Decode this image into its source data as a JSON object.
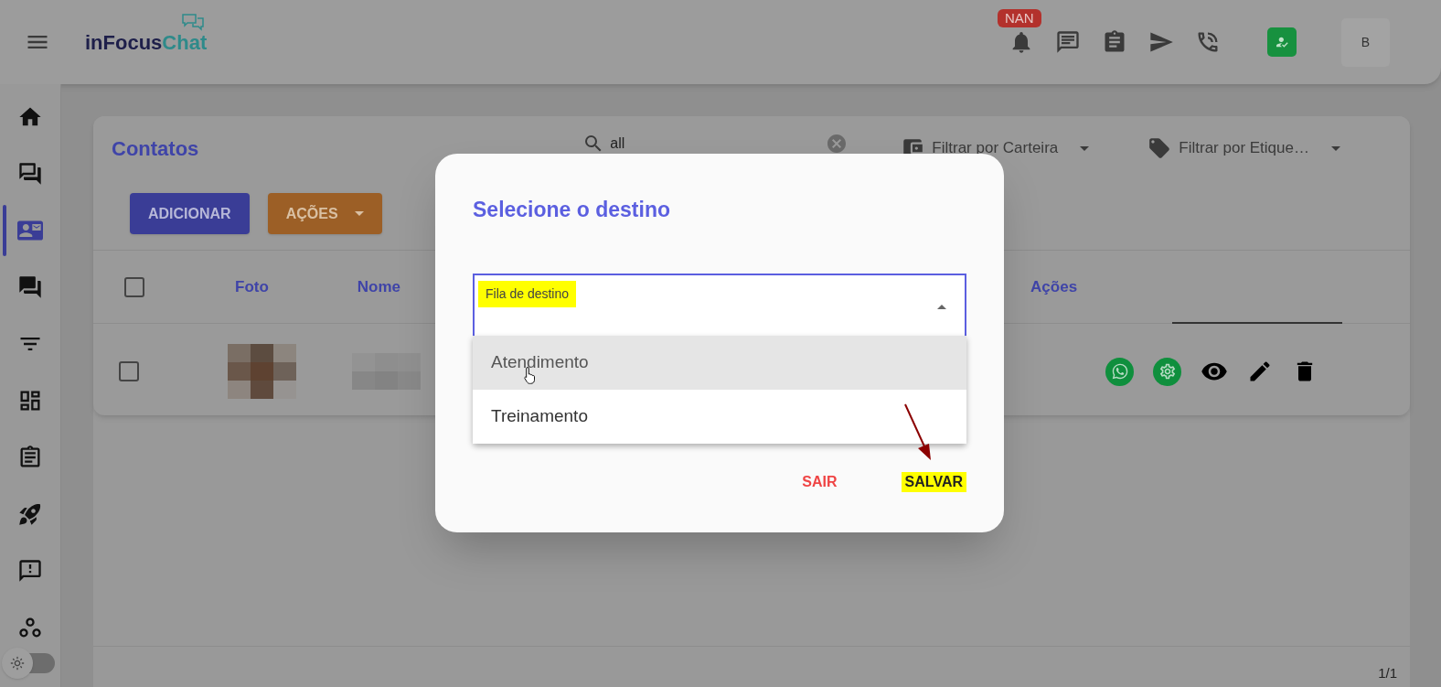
{
  "header": {
    "logo": {
      "dark_part": "inFocus",
      "accent_part": "Chat"
    },
    "notification_badge": "NAN",
    "avatar": "B"
  },
  "sidebar": {
    "items": [
      {
        "kind": "home",
        "selected": false
      },
      {
        "kind": "forum",
        "selected": false
      },
      {
        "kind": "contacts",
        "selected": true
      },
      {
        "kind": "chat",
        "selected": false
      },
      {
        "kind": "filter",
        "selected": false
      },
      {
        "kind": "dashboard",
        "selected": false
      },
      {
        "kind": "tasks",
        "selected": false
      },
      {
        "kind": "rocket",
        "selected": false
      },
      {
        "kind": "feedback",
        "selected": false
      },
      {
        "kind": "hexagons",
        "selected": false
      }
    ],
    "theme_toggle": {
      "on": false
    }
  },
  "page": {
    "title": "Contatos",
    "search": {
      "value": "all"
    },
    "filters": [
      {
        "kind": "wallet",
        "label": "Filtrar por Carteira"
      },
      {
        "kind": "tag",
        "label": "Filtrar por Etique…"
      }
    ],
    "buttons": [
      {
        "kind": "primary",
        "label": "ADICIONAR"
      },
      {
        "kind": "menu",
        "label": "AÇÕES"
      }
    ]
  },
  "table": {
    "select_all": {
      "checked": false
    },
    "columns": [
      {
        "label": "Foto"
      },
      {
        "label": "Nome"
      },
      {
        "label": "Ações"
      }
    ],
    "rows": [
      {
        "checked": false
      }
    ]
  },
  "pagination": "1/1",
  "dialog": {
    "title": "Selecione o destino",
    "field": {
      "label": "Fila de destino",
      "highlighted": true,
      "expanded": true
    },
    "options": [
      {
        "label": "Atendimento",
        "selected": true
      },
      {
        "label": "Treinamento",
        "selected": false
      }
    ],
    "actions": [
      {
        "kind": "cancel",
        "label": "SAIR",
        "highlighted": false
      },
      {
        "kind": "save",
        "label": "SALVAR",
        "highlighted": true
      }
    ]
  }
}
